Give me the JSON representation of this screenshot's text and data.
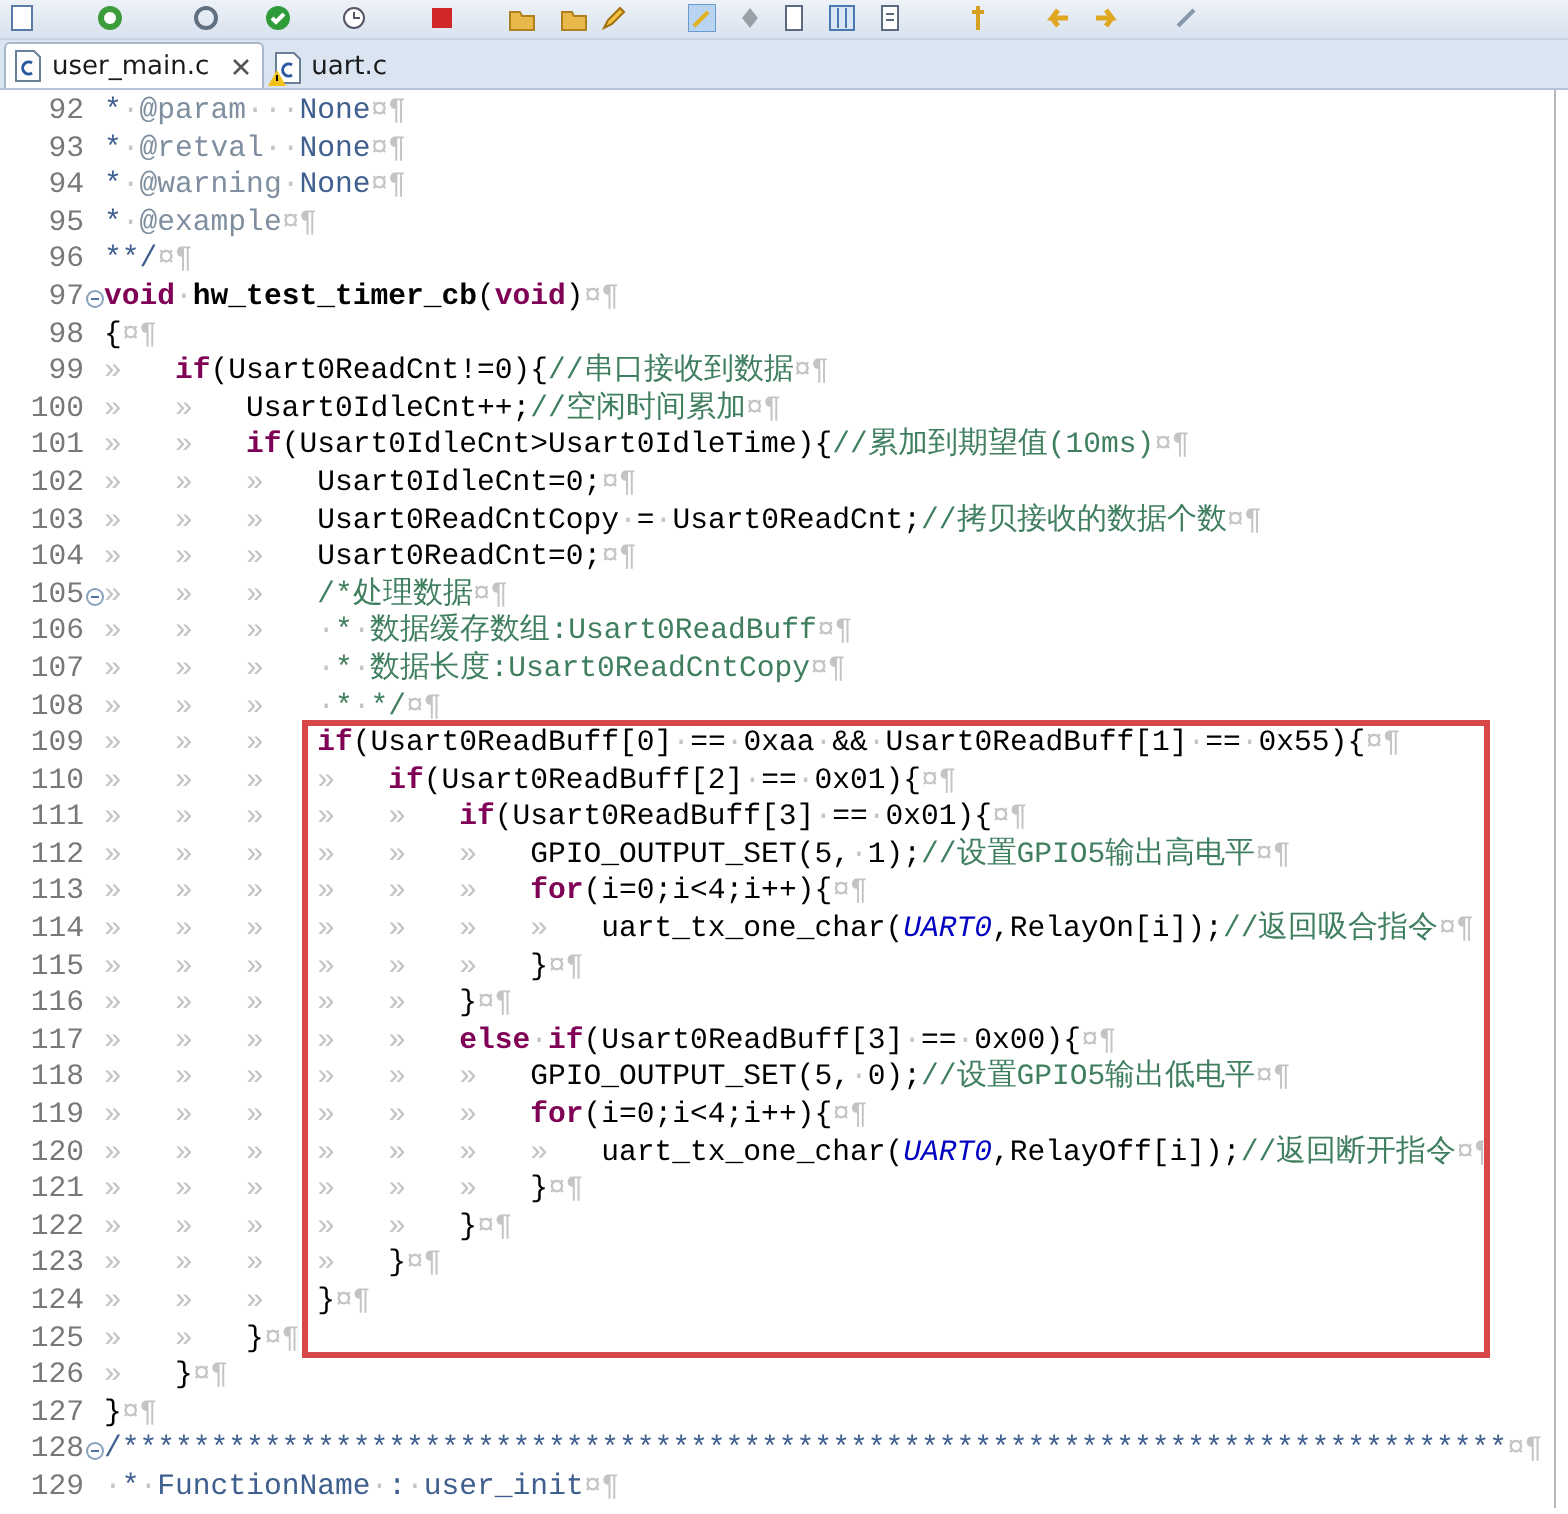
{
  "tabs": [
    {
      "label": "user_main.c",
      "selected": true,
      "closable": true,
      "warning": false
    },
    {
      "label": "uart.c",
      "selected": false,
      "closable": false,
      "warning": true
    }
  ],
  "lines": [
    {
      "number": "92",
      "fold": false,
      "boxed": false,
      "tokens": [
        {
          "kind": "doc",
          "text": "*"
        },
        {
          "kind": "ws",
          "text": "·"
        },
        {
          "kind": "tag",
          "text": "@param"
        },
        {
          "kind": "ws",
          "text": "···"
        },
        {
          "kind": "doc",
          "text": "None"
        },
        {
          "kind": "ws",
          "text": "¤¶"
        }
      ]
    },
    {
      "number": "93",
      "fold": false,
      "boxed": false,
      "tokens": [
        {
          "kind": "doc",
          "text": "*"
        },
        {
          "kind": "ws",
          "text": "·"
        },
        {
          "kind": "tag",
          "text": "@retval"
        },
        {
          "kind": "ws",
          "text": "··"
        },
        {
          "kind": "doc",
          "text": "None"
        },
        {
          "kind": "ws",
          "text": "¤¶"
        }
      ]
    },
    {
      "number": "94",
      "fold": false,
      "boxed": false,
      "tokens": [
        {
          "kind": "doc",
          "text": "*"
        },
        {
          "kind": "ws",
          "text": "·"
        },
        {
          "kind": "tag",
          "text": "@warning"
        },
        {
          "kind": "ws",
          "text": "·"
        },
        {
          "kind": "doc",
          "text": "None"
        },
        {
          "kind": "ws",
          "text": "¤¶"
        }
      ]
    },
    {
      "number": "95",
      "fold": false,
      "boxed": false,
      "tokens": [
        {
          "kind": "doc",
          "text": "*"
        },
        {
          "kind": "ws",
          "text": "·"
        },
        {
          "kind": "tag",
          "text": "@example"
        },
        {
          "kind": "ws",
          "text": "¤¶"
        }
      ]
    },
    {
      "number": "96",
      "fold": false,
      "boxed": false,
      "tokens": [
        {
          "kind": "doc",
          "text": "**/"
        },
        {
          "kind": "ws",
          "text": "¤¶"
        }
      ]
    },
    {
      "number": "97",
      "fold": true,
      "boxed": false,
      "tokens": [
        {
          "kind": "kw",
          "text": "void"
        },
        {
          "kind": "ws",
          "text": "·"
        },
        {
          "kind": "fn",
          "text": "hw_test_timer_cb"
        },
        {
          "kind": "plain",
          "text": "("
        },
        {
          "kind": "kw",
          "text": "void"
        },
        {
          "kind": "plain",
          "text": ")"
        },
        {
          "kind": "ws",
          "text": "¤¶"
        }
      ]
    },
    {
      "number": "98",
      "fold": false,
      "boxed": false,
      "tokens": [
        {
          "kind": "plain",
          "text": "{"
        },
        {
          "kind": "ws",
          "text": "¤¶"
        }
      ]
    },
    {
      "number": "99",
      "fold": false,
      "boxed": false,
      "tokens": [
        {
          "kind": "ws",
          "text": "»\t"
        },
        {
          "kind": "kw",
          "text": "if"
        },
        {
          "kind": "plain",
          "text": "(Usart0ReadCnt!=0){"
        },
        {
          "kind": "comment",
          "text": "//串口接收到数据"
        },
        {
          "kind": "ws",
          "text": "¤¶"
        }
      ]
    },
    {
      "number": "100",
      "fold": false,
      "boxed": false,
      "tokens": [
        {
          "kind": "ws",
          "text": "»\t»\t"
        },
        {
          "kind": "plain",
          "text": "Usart0IdleCnt++;"
        },
        {
          "kind": "comment",
          "text": "//空闲时间累加"
        },
        {
          "kind": "ws",
          "text": "¤¶"
        }
      ]
    },
    {
      "number": "101",
      "fold": false,
      "boxed": false,
      "tokens": [
        {
          "kind": "ws",
          "text": "»\t»\t"
        },
        {
          "kind": "kw",
          "text": "if"
        },
        {
          "kind": "plain",
          "text": "(Usart0IdleCnt>Usart0IdleTime){"
        },
        {
          "kind": "comment",
          "text": "//累加到期望值(10ms)"
        },
        {
          "kind": "ws",
          "text": "¤¶"
        }
      ]
    },
    {
      "number": "102",
      "fold": false,
      "boxed": false,
      "tokens": [
        {
          "kind": "ws",
          "text": "»\t»\t»\t"
        },
        {
          "kind": "plain",
          "text": "Usart0IdleCnt=0;"
        },
        {
          "kind": "ws",
          "text": "¤¶"
        }
      ]
    },
    {
      "number": "103",
      "fold": false,
      "boxed": false,
      "tokens": [
        {
          "kind": "ws",
          "text": "»\t»\t»\t"
        },
        {
          "kind": "plain",
          "text": "Usart0ReadCntCopy"
        },
        {
          "kind": "ws",
          "text": "·"
        },
        {
          "kind": "plain",
          "text": "="
        },
        {
          "kind": "ws",
          "text": "·"
        },
        {
          "kind": "plain",
          "text": "Usart0ReadCnt;"
        },
        {
          "kind": "comment",
          "text": "//拷贝接收的数据个数"
        },
        {
          "kind": "ws",
          "text": "¤¶"
        }
      ]
    },
    {
      "number": "104",
      "fold": false,
      "boxed": false,
      "tokens": [
        {
          "kind": "ws",
          "text": "»\t»\t»\t"
        },
        {
          "kind": "plain",
          "text": "Usart0ReadCnt=0;"
        },
        {
          "kind": "ws",
          "text": "¤¶"
        }
      ]
    },
    {
      "number": "105",
      "fold": true,
      "boxed": false,
      "tokens": [
        {
          "kind": "ws",
          "text": "»\t»\t»\t"
        },
        {
          "kind": "comment",
          "text": "/*处理数据"
        },
        {
          "kind": "ws",
          "text": "¤¶"
        }
      ]
    },
    {
      "number": "106",
      "fold": false,
      "boxed": false,
      "tokens": [
        {
          "kind": "ws",
          "text": "»\t»\t»\t·"
        },
        {
          "kind": "comment",
          "text": "*"
        },
        {
          "kind": "ws",
          "text": "·"
        },
        {
          "kind": "comment",
          "text": "数据缓存数组:Usart0ReadBuff"
        },
        {
          "kind": "ws",
          "text": "¤¶"
        }
      ]
    },
    {
      "number": "107",
      "fold": false,
      "boxed": false,
      "tokens": [
        {
          "kind": "ws",
          "text": "»\t»\t»\t·"
        },
        {
          "kind": "comment",
          "text": "*"
        },
        {
          "kind": "ws",
          "text": "·"
        },
        {
          "kind": "comment",
          "text": "数据长度:Usart0ReadCntCopy"
        },
        {
          "kind": "ws",
          "text": "¤¶"
        }
      ]
    },
    {
      "number": "108",
      "fold": false,
      "boxed": false,
      "tokens": [
        {
          "kind": "ws",
          "text": "»\t»\t»\t·"
        },
        {
          "kind": "comment",
          "text": "*"
        },
        {
          "kind": "ws",
          "text": "·"
        },
        {
          "kind": "comment",
          "text": "*/"
        },
        {
          "kind": "ws",
          "text": "¤¶"
        }
      ]
    },
    {
      "number": "109",
      "fold": false,
      "boxed": true,
      "tokens": [
        {
          "kind": "ws",
          "text": "»\t»\t»\t"
        },
        {
          "kind": "kw",
          "text": "if"
        },
        {
          "kind": "plain",
          "text": "(Usart0ReadBuff[0]"
        },
        {
          "kind": "ws",
          "text": "·"
        },
        {
          "kind": "plain",
          "text": "=="
        },
        {
          "kind": "ws",
          "text": "·"
        },
        {
          "kind": "plain",
          "text": "0xaa"
        },
        {
          "kind": "ws",
          "text": "·"
        },
        {
          "kind": "plain",
          "text": "&&"
        },
        {
          "kind": "ws",
          "text": "·"
        },
        {
          "kind": "plain",
          "text": "Usart0ReadBuff[1]"
        },
        {
          "kind": "ws",
          "text": "·"
        },
        {
          "kind": "plain",
          "text": "=="
        },
        {
          "kind": "ws",
          "text": "·"
        },
        {
          "kind": "plain",
          "text": "0x55){"
        },
        {
          "kind": "ws",
          "text": "¤¶"
        }
      ]
    },
    {
      "number": "110",
      "fold": false,
      "boxed": true,
      "tokens": [
        {
          "kind": "ws",
          "text": "»\t»\t»\t»\t"
        },
        {
          "kind": "kw",
          "text": "if"
        },
        {
          "kind": "plain",
          "text": "(Usart0ReadBuff[2]"
        },
        {
          "kind": "ws",
          "text": "·"
        },
        {
          "kind": "plain",
          "text": "=="
        },
        {
          "kind": "ws",
          "text": "·"
        },
        {
          "kind": "plain",
          "text": "0x01){"
        },
        {
          "kind": "ws",
          "text": "¤¶"
        }
      ]
    },
    {
      "number": "111",
      "fold": false,
      "boxed": true,
      "tokens": [
        {
          "kind": "ws",
          "text": "»\t»\t»\t»\t»\t"
        },
        {
          "kind": "kw",
          "text": "if"
        },
        {
          "kind": "plain",
          "text": "(Usart0ReadBuff[3]"
        },
        {
          "kind": "ws",
          "text": "·"
        },
        {
          "kind": "plain",
          "text": "=="
        },
        {
          "kind": "ws",
          "text": "·"
        },
        {
          "kind": "plain",
          "text": "0x01){"
        },
        {
          "kind": "ws",
          "text": "¤¶"
        }
      ]
    },
    {
      "number": "112",
      "fold": false,
      "boxed": true,
      "tokens": [
        {
          "kind": "ws",
          "text": "»\t»\t»\t»\t»\t»\t"
        },
        {
          "kind": "plain",
          "text": "GPIO_OUTPUT_SET(5,"
        },
        {
          "kind": "ws",
          "text": "·"
        },
        {
          "kind": "plain",
          "text": "1);"
        },
        {
          "kind": "comment",
          "text": "//设置GPIO5输出高电平"
        },
        {
          "kind": "ws",
          "text": "¤¶"
        }
      ]
    },
    {
      "number": "113",
      "fold": false,
      "boxed": true,
      "tokens": [
        {
          "kind": "ws",
          "text": "»\t»\t»\t»\t»\t»\t"
        },
        {
          "kind": "kw",
          "text": "for"
        },
        {
          "kind": "plain",
          "text": "(i=0;i<4;i++){"
        },
        {
          "kind": "ws",
          "text": "¤¶"
        }
      ]
    },
    {
      "number": "114",
      "fold": false,
      "boxed": true,
      "tokens": [
        {
          "kind": "ws",
          "text": "»\t»\t»\t»\t»\t»\t»\t"
        },
        {
          "kind": "plain",
          "text": "uart_tx_one_char("
        },
        {
          "kind": "const",
          "text": "UART0"
        },
        {
          "kind": "plain",
          "text": ",RelayOn[i]);"
        },
        {
          "kind": "comment",
          "text": "//返回吸合指令"
        },
        {
          "kind": "ws",
          "text": "¤¶"
        }
      ]
    },
    {
      "number": "115",
      "fold": false,
      "boxed": true,
      "tokens": [
        {
          "kind": "ws",
          "text": "»\t»\t»\t»\t»\t»\t"
        },
        {
          "kind": "plain",
          "text": "}"
        },
        {
          "kind": "ws",
          "text": "¤¶"
        }
      ]
    },
    {
      "number": "116",
      "fold": false,
      "boxed": true,
      "tokens": [
        {
          "kind": "ws",
          "text": "»\t»\t»\t»\t»\t"
        },
        {
          "kind": "plain",
          "text": "}"
        },
        {
          "kind": "ws",
          "text": "¤¶"
        }
      ]
    },
    {
      "number": "117",
      "fold": false,
      "boxed": true,
      "tokens": [
        {
          "kind": "ws",
          "text": "»\t»\t»\t»\t»\t"
        },
        {
          "kind": "kw",
          "text": "else"
        },
        {
          "kind": "ws",
          "text": "·"
        },
        {
          "kind": "kw",
          "text": "if"
        },
        {
          "kind": "plain",
          "text": "(Usart0ReadBuff[3]"
        },
        {
          "kind": "ws",
          "text": "·"
        },
        {
          "kind": "plain",
          "text": "=="
        },
        {
          "kind": "ws",
          "text": "·"
        },
        {
          "kind": "plain",
          "text": "0x00){"
        },
        {
          "kind": "ws",
          "text": "¤¶"
        }
      ]
    },
    {
      "number": "118",
      "fold": false,
      "boxed": true,
      "tokens": [
        {
          "kind": "ws",
          "text": "»\t»\t»\t»\t»\t»\t"
        },
        {
          "kind": "plain",
          "text": "GPIO_OUTPUT_SET(5,"
        },
        {
          "kind": "ws",
          "text": "·"
        },
        {
          "kind": "plain",
          "text": "0);"
        },
        {
          "kind": "comment",
          "text": "//设置GPIO5输出低电平"
        },
        {
          "kind": "ws",
          "text": "¤¶"
        }
      ]
    },
    {
      "number": "119",
      "fold": false,
      "boxed": true,
      "tokens": [
        {
          "kind": "ws",
          "text": "»\t»\t»\t»\t»\t»\t"
        },
        {
          "kind": "kw",
          "text": "for"
        },
        {
          "kind": "plain",
          "text": "(i=0;i<4;i++){"
        },
        {
          "kind": "ws",
          "text": "¤¶"
        }
      ]
    },
    {
      "number": "120",
      "fold": false,
      "boxed": true,
      "tokens": [
        {
          "kind": "ws",
          "text": "»\t»\t»\t»\t»\t»\t»\t"
        },
        {
          "kind": "plain",
          "text": "uart_tx_one_char("
        },
        {
          "kind": "const",
          "text": "UART0"
        },
        {
          "kind": "plain",
          "text": ",RelayOff[i]);"
        },
        {
          "kind": "comment",
          "text": "//返回断开指令"
        },
        {
          "kind": "ws",
          "text": "¤¶"
        }
      ]
    },
    {
      "number": "121",
      "fold": false,
      "boxed": true,
      "tokens": [
        {
          "kind": "ws",
          "text": "»\t»\t»\t»\t»\t»\t"
        },
        {
          "kind": "plain",
          "text": "}"
        },
        {
          "kind": "ws",
          "text": "¤¶"
        }
      ]
    },
    {
      "number": "122",
      "fold": false,
      "boxed": true,
      "tokens": [
        {
          "kind": "ws",
          "text": "»\t»\t»\t»\t»\t"
        },
        {
          "kind": "plain",
          "text": "}"
        },
        {
          "kind": "ws",
          "text": "¤¶"
        }
      ]
    },
    {
      "number": "123",
      "fold": false,
      "boxed": true,
      "tokens": [
        {
          "kind": "ws",
          "text": "»\t»\t»\t»\t"
        },
        {
          "kind": "plain",
          "text": "}"
        },
        {
          "kind": "ws",
          "text": "¤¶"
        }
      ]
    },
    {
      "number": "124",
      "fold": false,
      "boxed": true,
      "tokens": [
        {
          "kind": "ws",
          "text": "»\t»\t»\t"
        },
        {
          "kind": "plain",
          "text": "}"
        },
        {
          "kind": "ws",
          "text": "¤¶"
        }
      ]
    },
    {
      "number": "125",
      "fold": false,
      "boxed": false,
      "tokens": [
        {
          "kind": "ws",
          "text": "»\t»\t"
        },
        {
          "kind": "plain",
          "text": "}"
        },
        {
          "kind": "ws",
          "text": "¤¶"
        }
      ]
    },
    {
      "number": "126",
      "fold": false,
      "boxed": false,
      "tokens": [
        {
          "kind": "ws",
          "text": "»\t"
        },
        {
          "kind": "plain",
          "text": "}"
        },
        {
          "kind": "ws",
          "text": "¤¶"
        }
      ]
    },
    {
      "number": "127",
      "fold": false,
      "boxed": false,
      "tokens": [
        {
          "kind": "plain",
          "text": "}"
        },
        {
          "kind": "ws",
          "text": "¤¶"
        }
      ]
    },
    {
      "number": "128",
      "fold": true,
      "boxed": false,
      "tokens": [
        {
          "kind": "doc",
          "text": "/******************************************************************************"
        },
        {
          "kind": "ws",
          "text": "¤¶"
        }
      ]
    },
    {
      "number": "129",
      "fold": false,
      "boxed": false,
      "tokens": [
        {
          "kind": "ws",
          "text": "·"
        },
        {
          "kind": "doc",
          "text": "*"
        },
        {
          "kind": "ws",
          "text": "·"
        },
        {
          "kind": "doc",
          "text": "FunctionName"
        },
        {
          "kind": "ws",
          "text": "·"
        },
        {
          "kind": "doc",
          "text": ":"
        },
        {
          "kind": "ws",
          "text": "·"
        },
        {
          "kind": "doc",
          "text": "user_init"
        },
        {
          "kind": "ws",
          "text": "¤¶"
        }
      ]
    }
  ]
}
